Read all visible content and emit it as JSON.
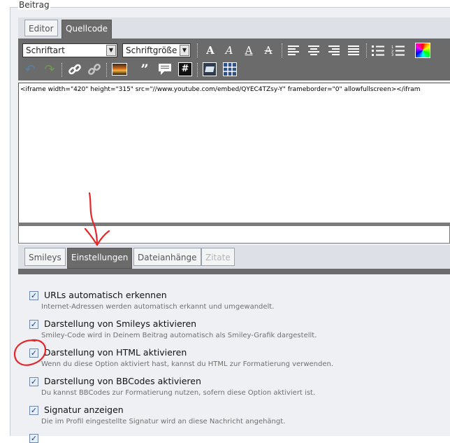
{
  "fieldset": {
    "legend": "Beitrag"
  },
  "tabs": [
    {
      "label": "Editor",
      "active": false
    },
    {
      "label": "Quellcode",
      "active": true
    }
  ],
  "toolbar": {
    "font_select": "Schriftart",
    "size_select": "Schriftgröße",
    "icons": [
      "bold-icon",
      "italic-icon",
      "underline-icon",
      "strikethrough-icon",
      "align-left-icon",
      "align-center-icon",
      "align-right-icon",
      "align-justify-icon",
      "bulleted-list-icon",
      "numbered-list-icon",
      "color-picker-icon",
      "undo-icon",
      "redo-icon",
      "link-icon",
      "unlink-icon",
      "image-icon",
      "quote-icon",
      "speech-bubble-icon",
      "hash-code-icon",
      "media-icon",
      "table-icon"
    ]
  },
  "editor": {
    "content": "<iframe width=\"420\" height=\"315\" src=\"//www.youtube.com/embed/QYEC4TZsy-Y\" frameborder=\"0\" allowfullscreen></ifram"
  },
  "bottom_tabs": [
    {
      "label": "Smileys",
      "state": "normal"
    },
    {
      "label": "Einstellungen",
      "state": "active"
    },
    {
      "label": "Dateianhänge",
      "state": "normal"
    },
    {
      "label": "Zitate",
      "state": "disabled"
    }
  ],
  "options": [
    {
      "label": "URLs automatisch erkennen",
      "description": "Internet-Adressen werden automatisch erkannt und umgewandelt.",
      "checked": true
    },
    {
      "label": "Darstellung von Smileys aktivieren",
      "description": "Smiley-Code wird in Deinem Beitrag automatisch als Smiley-Grafik dargestellt.",
      "checked": true
    },
    {
      "label": "Darstellung von HTML aktivieren",
      "description": "Wenn du diese Option aktiviert hast, kannst du HTML zur Formatierung verwenden.",
      "checked": true
    },
    {
      "label": "Darstellung von BBCodes aktivieren",
      "description": "Du kannst BBCodes zur Formatierung nutzen, sofern diese Option aktiviert ist.",
      "checked": true
    },
    {
      "label": "Signatur anzeigen",
      "description": "Die im Profil eingestellte Signatur wird an diese Nachricht angehängt.",
      "checked": true
    }
  ],
  "colors": {
    "toolbar_bg": "#6b6b6b",
    "annotation_red": "#e3262a",
    "checkbox_border": "#6e86a8"
  }
}
